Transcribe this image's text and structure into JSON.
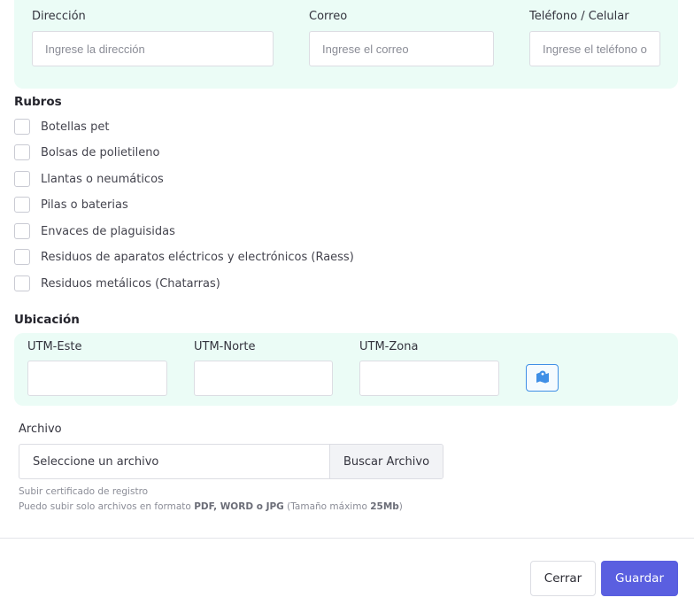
{
  "contact": {
    "direccion": {
      "label": "Dirección",
      "placeholder": "Ingrese la dirección"
    },
    "correo": {
      "label": "Correo",
      "placeholder": "Ingrese el correo"
    },
    "telefono": {
      "label": "Teléfono / Celular",
      "placeholder": "Ingrese el teléfono o"
    }
  },
  "rubros": {
    "title": "Rubros",
    "items": [
      {
        "label": "Botellas pet",
        "checked": false
      },
      {
        "label": "Bolsas de polietileno",
        "checked": false
      },
      {
        "label": "Llantas o neumáticos",
        "checked": false
      },
      {
        "label": "Pilas o baterias",
        "checked": false
      },
      {
        "label": "Envaces de plaguisidas",
        "checked": false
      },
      {
        "label": "Residuos de aparatos eléctricos y electrónicos (Raess)",
        "checked": false
      },
      {
        "label": "Residuos metálicos (Chatarras)",
        "checked": false
      }
    ]
  },
  "ubicacion": {
    "title": "Ubicación",
    "utm_este": {
      "label": "UTM-Este",
      "value": ""
    },
    "utm_norte": {
      "label": "UTM-Norte",
      "value": ""
    },
    "utm_zona": {
      "label": "UTM-Zona",
      "value": ""
    },
    "map_button_icon": "map-marker-icon"
  },
  "archivo": {
    "label": "Archivo",
    "input_text": "Seleccione un archivo",
    "button_label": "Buscar Archivo",
    "help_line1": "Subir certificado de registro",
    "help_line2_prefix": "Puedo subir solo archivos en formato ",
    "help_formats": "PDF, WORD o JPG",
    "help_line2_mid": " (Tamaño máximo ",
    "help_size": "25Mb",
    "help_line2_suffix": ")"
  },
  "footer": {
    "close_label": "Cerrar",
    "save_label": "Guardar"
  },
  "colors": {
    "panel_bg": "#ebfcf6",
    "primary": "#5a5fe0",
    "map_icon": "#3f8fe6"
  }
}
